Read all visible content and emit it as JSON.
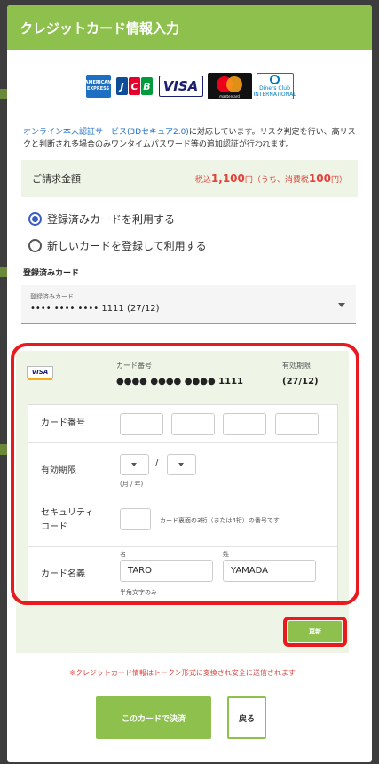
{
  "header": {
    "title": "クレジットカード情報入力"
  },
  "brands": {
    "amex": "AMERICAN EXPRESS",
    "jcb": [
      "J",
      "C",
      "B"
    ],
    "visa": "VISA",
    "mastercard": "mastercard",
    "diners": "Diners Club INTERNATIONAL"
  },
  "notice": {
    "link": "オンライン本人認証サービス(3Dセキュア2.0)",
    "text": "に対応しています。リスク判定を行い、高リスクと判断され多場合のみワンタイムパスワード等の追加認証が行われます。"
  },
  "amount": {
    "label": "ご請求金額",
    "prefix": "税込",
    "value": "1,100",
    "unit": "円",
    "tax_open": "（うち、消費税",
    "tax_value": "100",
    "tax_close": "円）"
  },
  "options": {
    "saved": "登録済みカードを利用する",
    "new": "新しいカードを登録して利用する"
  },
  "saved_card": {
    "section_title": "登録済みカード",
    "select_label": "登録済みカード",
    "select_value": "•••• •••• •••• 1111 (27/12)"
  },
  "card_summary": {
    "brand": "VISA",
    "number_label": "カード番号",
    "number_value": "●●●● ●●●● ●●●● 1111",
    "expiry_label": "有効期限",
    "expiry_value": "(27/12)"
  },
  "form": {
    "card_number_label": "カード番号",
    "expiry_label": "有効期限",
    "expiry_sep": "/",
    "expiry_hint": "(月 / 年)",
    "security_label_1": "セキュリティ",
    "security_label_2": "コード",
    "security_hint": "カード裏面の3桁（または4桁）の番号です",
    "name_label": "カード名義",
    "first_name_label": "名",
    "last_name_label": "姓",
    "first_name_value": "TARO",
    "last_name_value": "YAMADA",
    "name_hint": "半角文字のみ"
  },
  "buttons": {
    "update": "更新",
    "pay": "このカードで決済",
    "back": "戻る"
  },
  "warning": "※クレジットカード情報はトークン形式に変換され安全に送信されます",
  "colors": {
    "accent": "#8dc04c",
    "highlight": "#e8191f",
    "price": "#e0423c",
    "link": "#1f6fc5"
  }
}
